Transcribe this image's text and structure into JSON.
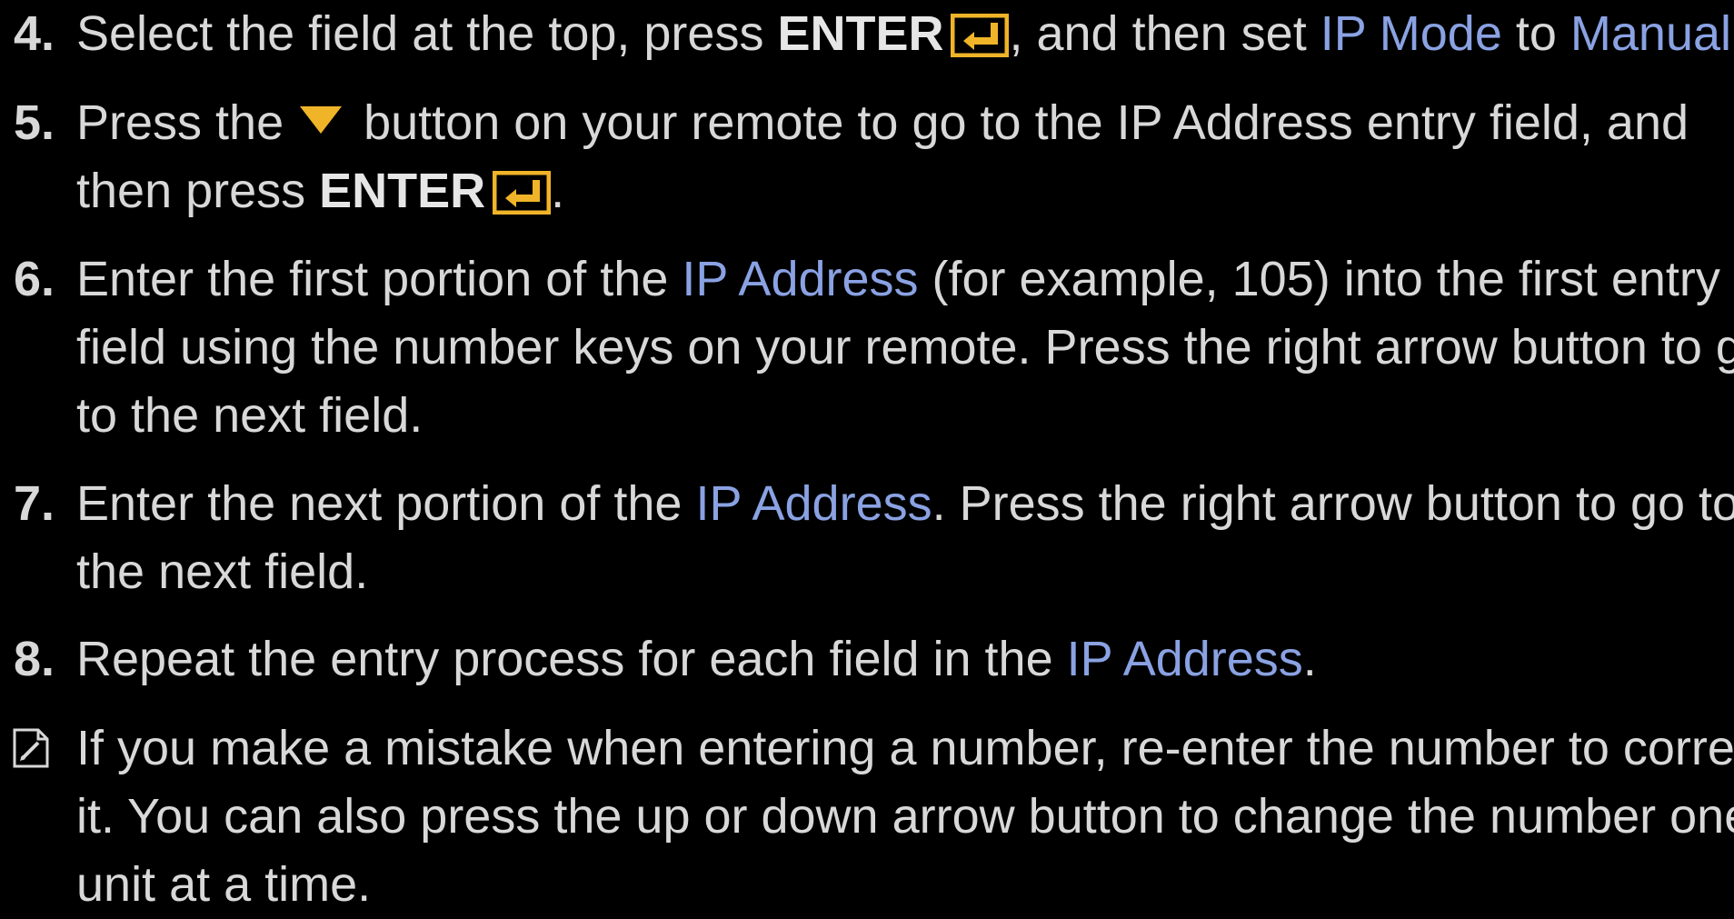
{
  "colors": {
    "background": "#000000",
    "text": "#d8d8d8",
    "highlight": "#8aa2e3",
    "icon_accent": "#f0b429"
  },
  "icons": {
    "enter": "enter-return-icon",
    "down": "down-triangle-icon",
    "note": "note-pencil-icon"
  },
  "steps": [
    {
      "number": "4.",
      "lines": [
        {
          "t1": "Select the field at the top, press ",
          "k1": "ENTER",
          "t2": ", and then set ",
          "h1": "IP Mode",
          "t3": " to ",
          "h2": "Manual",
          "t4": "."
        }
      ]
    },
    {
      "number": "5.",
      "lines": [
        {
          "t1": "Press the",
          "t2": "button on your remote to go to the IP Address entry field, and"
        },
        {
          "t1": "then press ",
          "k1": "ENTER",
          "t2": "."
        }
      ]
    },
    {
      "number": "6.",
      "lines": [
        {
          "t1": "Enter the first portion of the ",
          "h1": "IP Address",
          "t2": " (for example, 105) into the first entry"
        },
        {
          "t1": "field using the number keys on your remote. Press the right arrow button to go"
        },
        {
          "t1": "to the next field."
        }
      ]
    },
    {
      "number": "7.",
      "lines": [
        {
          "t1": "Enter the next portion of the ",
          "h1": "IP Address",
          "t2": ". Press the right arrow button to go to"
        },
        {
          "t1": "the next field."
        }
      ]
    },
    {
      "number": "8.",
      "lines": [
        {
          "t1": "Repeat the entry process for each field in the ",
          "h1": "IP Address",
          "t2": "."
        }
      ]
    }
  ],
  "note": {
    "lines": [
      "If you make a mistake when entering a number, re-enter the number to correct",
      "it. You can also press the up or down arrow button to change the number one",
      "unit at a time."
    ]
  }
}
